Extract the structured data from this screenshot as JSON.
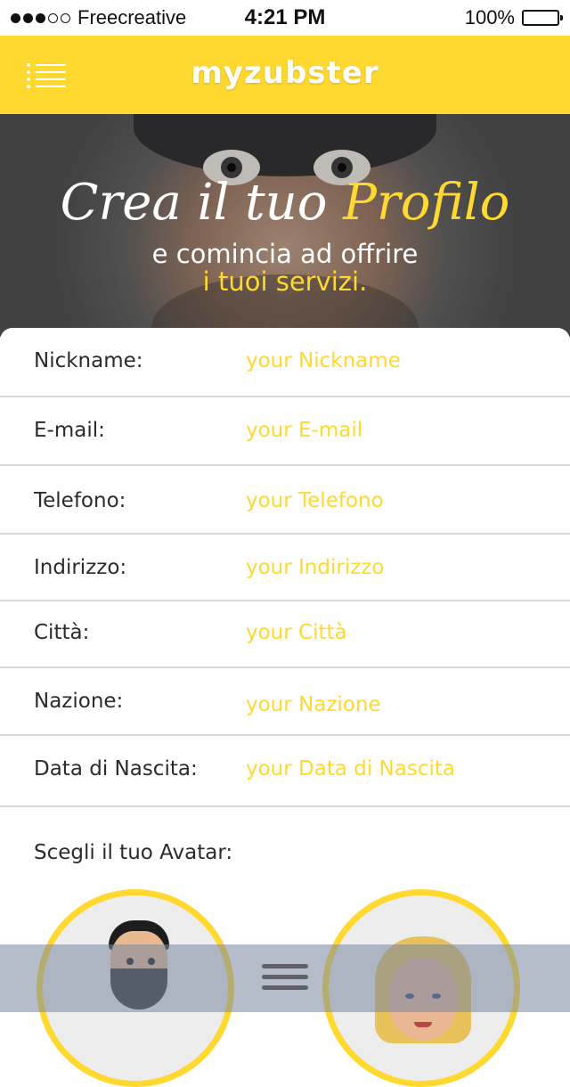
{
  "status_bar": {
    "carrier": "Freecreative",
    "time": "4:21 PM",
    "battery": "100%",
    "signal_bars_filled": 3,
    "signal_bars_total": 5
  },
  "nav": {
    "title": "myzubster",
    "menu_icon": "menu-list-icon"
  },
  "hero": {
    "title_white": "Crea il tuo ",
    "title_yellow": "Profilo",
    "subtitle": "e comincia ad offrire",
    "subtitle2": "i tuoi servizi."
  },
  "form": {
    "fields": [
      {
        "label": "Nickname:",
        "placeholder": "your Nickname"
      },
      {
        "label": "E-mail:",
        "placeholder": "your E-mail"
      },
      {
        "label": "Telefono:",
        "placeholder": "your Telefono"
      },
      {
        "label": "Indirizzo:",
        "placeholder": "your Indirizzo"
      },
      {
        "label": "Città:",
        "placeholder": "your Città"
      },
      {
        "label": "Nazione:",
        "placeholder": "your Nazione"
      },
      {
        "label": "Data di Nascita:",
        "placeholder": "your Data di Nascita"
      }
    ],
    "avatar_label": "Scegli il tuo Avatar:",
    "avatars": [
      "male-avatar",
      "female-avatar"
    ]
  },
  "colors": {
    "accent": "#ffd92f",
    "text": "#2b2b2b",
    "divider": "#d9d9d9"
  }
}
